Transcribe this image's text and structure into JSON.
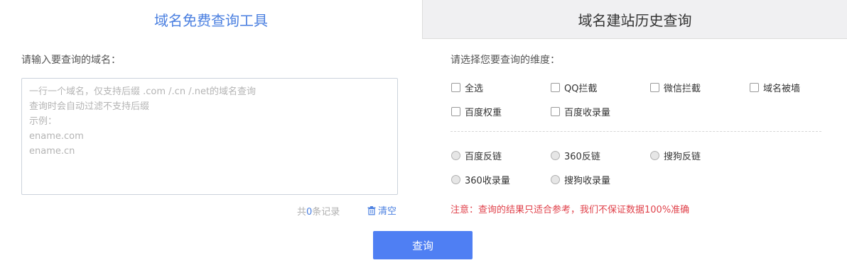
{
  "tabs": {
    "free_tool": "域名免费查询工具",
    "history": "域名建站历史查询"
  },
  "left": {
    "label": "请输入要查询的域名：",
    "textarea_placeholder": "一行一个域名，仅支持后缀 .com /.cn /.net的域名查询\n查询时会自动过滤不支持后缀\n示例：\nename.com\nename.cn",
    "textarea_value": "",
    "record_prefix": "共",
    "record_count": "0",
    "record_suffix": "条记录",
    "clear_label": "清空"
  },
  "right": {
    "label": "请选择您要查询的维度：",
    "checkboxes": [
      "全选",
      "QQ拦截",
      "微信拦截",
      "域名被墙",
      "百度权重",
      "百度收录量"
    ],
    "radios": [
      "百度反链",
      "360反链",
      "搜狗反链",
      "360收录量",
      "搜狗收录量"
    ],
    "notice": "注意：查询的结果只适合参考，我们不保证数据100%准确"
  },
  "query_label": "查询",
  "colors": {
    "accent": "#4a7fe0",
    "button": "#4f7ff3",
    "notice": "#e0424b"
  }
}
